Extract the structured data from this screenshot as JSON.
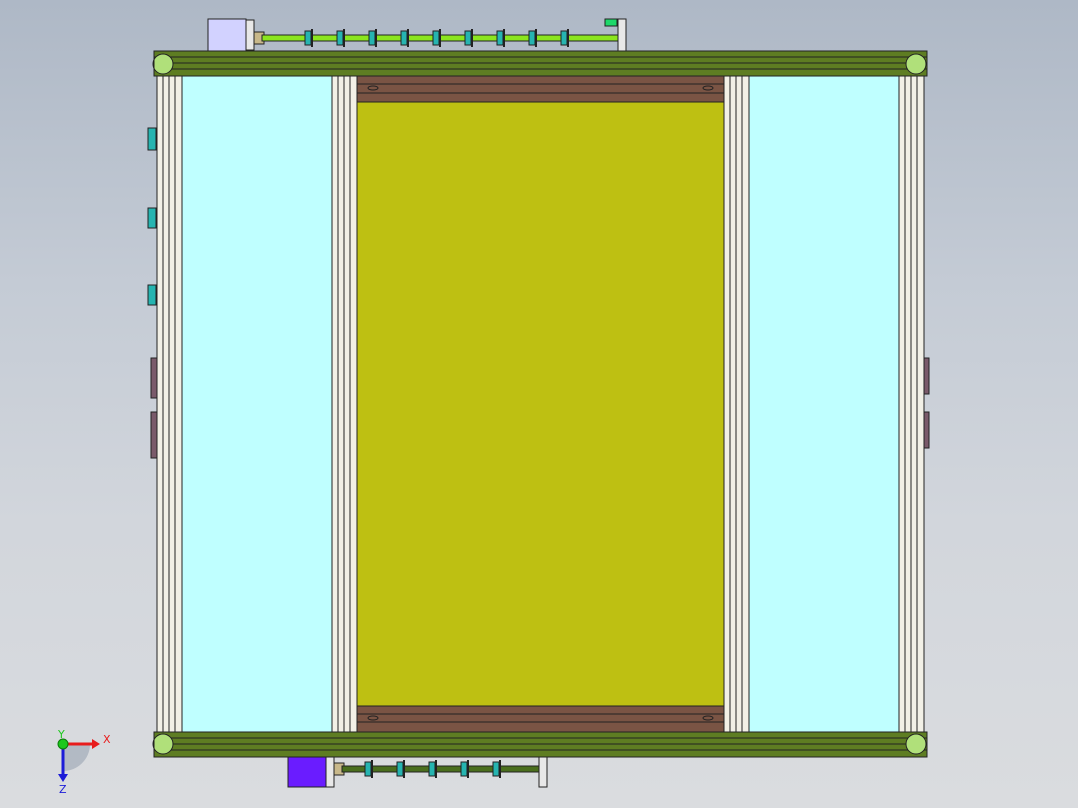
{
  "viewport": {
    "background_top": "#aeb8c6",
    "background_bottom": "#dadcdf"
  },
  "triad": {
    "x_label": "X",
    "y_label": "Y",
    "z_label": "Z",
    "x_color": "#e81c1c",
    "y_color": "#1cc81c",
    "z_color": "#1c1cd8"
  },
  "model": {
    "frame_color": "#5e7d22",
    "panel_color": "#bec012",
    "side_panel_color": "#bfffff",
    "rail_color": "#f2f0e6",
    "belt_color": "#7a5444",
    "shaft_color": "#8be51e",
    "motor_top_color": "#d2d2ff",
    "motor_bottom_color": "#6a1cff",
    "roller_color": "#26b4b0"
  }
}
